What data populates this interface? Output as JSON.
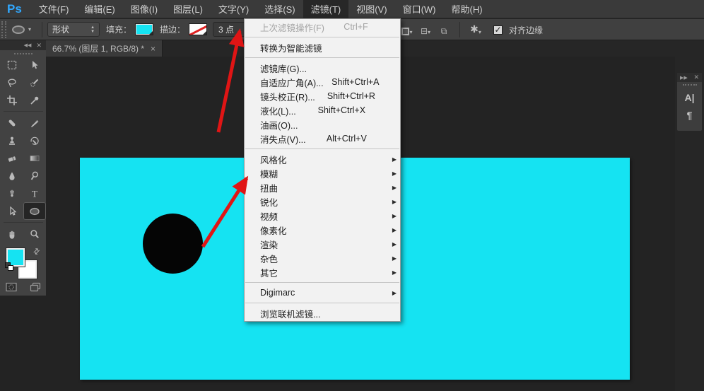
{
  "app": {
    "logo_text": "Ps"
  },
  "menubar": {
    "items": [
      "文件(F)",
      "编辑(E)",
      "图像(I)",
      "图层(L)",
      "文字(Y)",
      "选择(S)",
      "滤镜(T)",
      "视图(V)",
      "窗口(W)",
      "帮助(H)"
    ],
    "active_item": "滤镜(T)"
  },
  "options_bar": {
    "mode_select_value": "形状",
    "fill_label": "填充：",
    "stroke_label": "描边：",
    "stroke_width_value": "3 点",
    "align_edges_label": "对齐边缘"
  },
  "tab_bar": {
    "document_tab": {
      "title": "66.7% (图层 1, RGB/8) *",
      "close_glyph": "×"
    }
  },
  "filter_menu": {
    "items": [
      {
        "label": "上次滤镜操作(F)",
        "shortcut": "Ctrl+F",
        "disabled": true
      },
      {
        "label": "转换为智能滤镜"
      },
      {
        "label": "滤镜库(G)..."
      },
      {
        "label": "自适应广角(A)...",
        "shortcut": "Shift+Ctrl+A"
      },
      {
        "label": "镜头校正(R)...",
        "shortcut": "Shift+Ctrl+R"
      },
      {
        "label": "液化(L)...",
        "shortcut": "Shift+Ctrl+X"
      },
      {
        "label": "油画(O)..."
      },
      {
        "label": "消失点(V)...",
        "shortcut": "Alt+Ctrl+V"
      },
      {
        "label": "风格化",
        "submenu": true
      },
      {
        "label": "模糊",
        "submenu": true
      },
      {
        "label": "扭曲",
        "submenu": true
      },
      {
        "label": "锐化",
        "submenu": true
      },
      {
        "label": "视频",
        "submenu": true
      },
      {
        "label": "像素化",
        "submenu": true
      },
      {
        "label": "渲染",
        "submenu": true
      },
      {
        "label": "杂色",
        "submenu": true
      },
      {
        "label": "其它",
        "submenu": true
      },
      {
        "label": "Digimarc",
        "submenu": true
      },
      {
        "label": "浏览联机滤镜..."
      }
    ]
  },
  "right_dock": {
    "character_panel_glyph": "A|",
    "paragraph_panel_glyph": "¶"
  },
  "icons": {
    "dropdown": "▾",
    "spin_up": "▲",
    "spin_down": "▼",
    "collapse_left": "◀◀",
    "collapse_right": "▶▶",
    "close": "✕",
    "check": "✓",
    "swap": "⇄",
    "gear": "✱",
    "submenu_arrow": "▶",
    "type_tool": "T"
  },
  "colors": {
    "canvas_cyan": "#15e3f2",
    "arrow_red": "#e01515",
    "logo_blue": "#31a8ff"
  }
}
